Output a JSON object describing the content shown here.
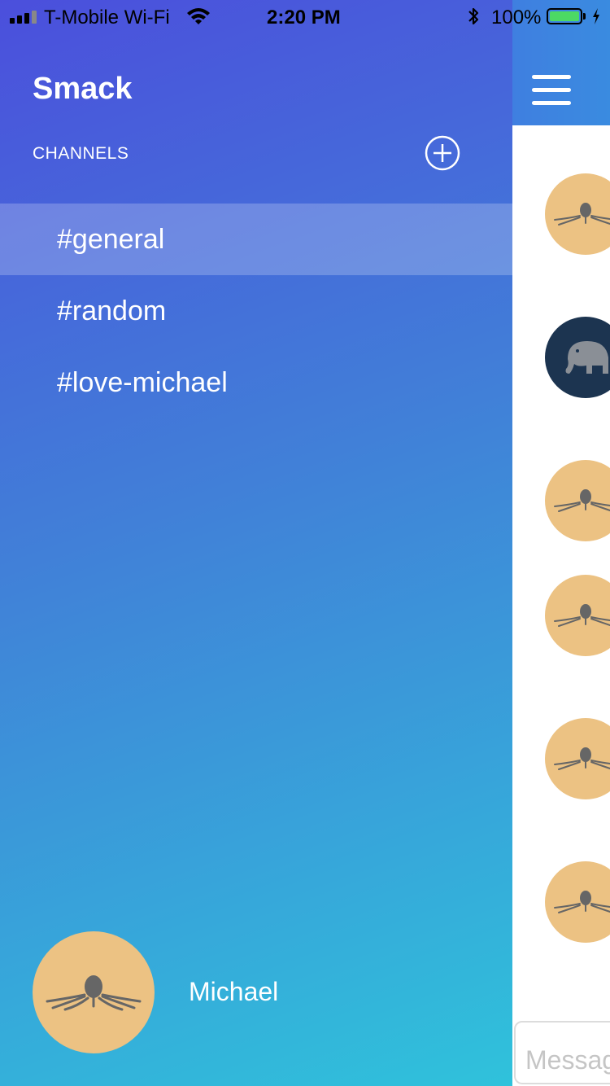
{
  "status_bar": {
    "carrier": "T-Mobile Wi-Fi",
    "time": "2:20 PM",
    "battery_percent": "100%",
    "icons": [
      "signal-icon",
      "wifi-icon",
      "bluetooth-icon",
      "battery-icon",
      "charging-icon"
    ]
  },
  "sidebar": {
    "app_title": "Smack",
    "channels_label": "CHANNELS",
    "channels": [
      {
        "label": "#general",
        "selected": true
      },
      {
        "label": "#random",
        "selected": false
      },
      {
        "label": "#love-michael",
        "selected": false
      }
    ],
    "user": {
      "name": "Michael",
      "avatar": "octopus-avatar"
    }
  },
  "main": {
    "menu_icon": "hamburger-menu-icon",
    "message_avatars": [
      "octopus-avatar",
      "elephant-avatar",
      "octopus-avatar",
      "octopus-avatar",
      "octopus-avatar",
      "octopus-avatar"
    ],
    "message_input_placeholder": "Message"
  },
  "colors": {
    "gradient_start": "#4b4fdc",
    "gradient_end": "#2fc2db",
    "avatar_tan": "#ecc283",
    "avatar_navy": "#1c3450",
    "battery_green": "#4cd964"
  }
}
